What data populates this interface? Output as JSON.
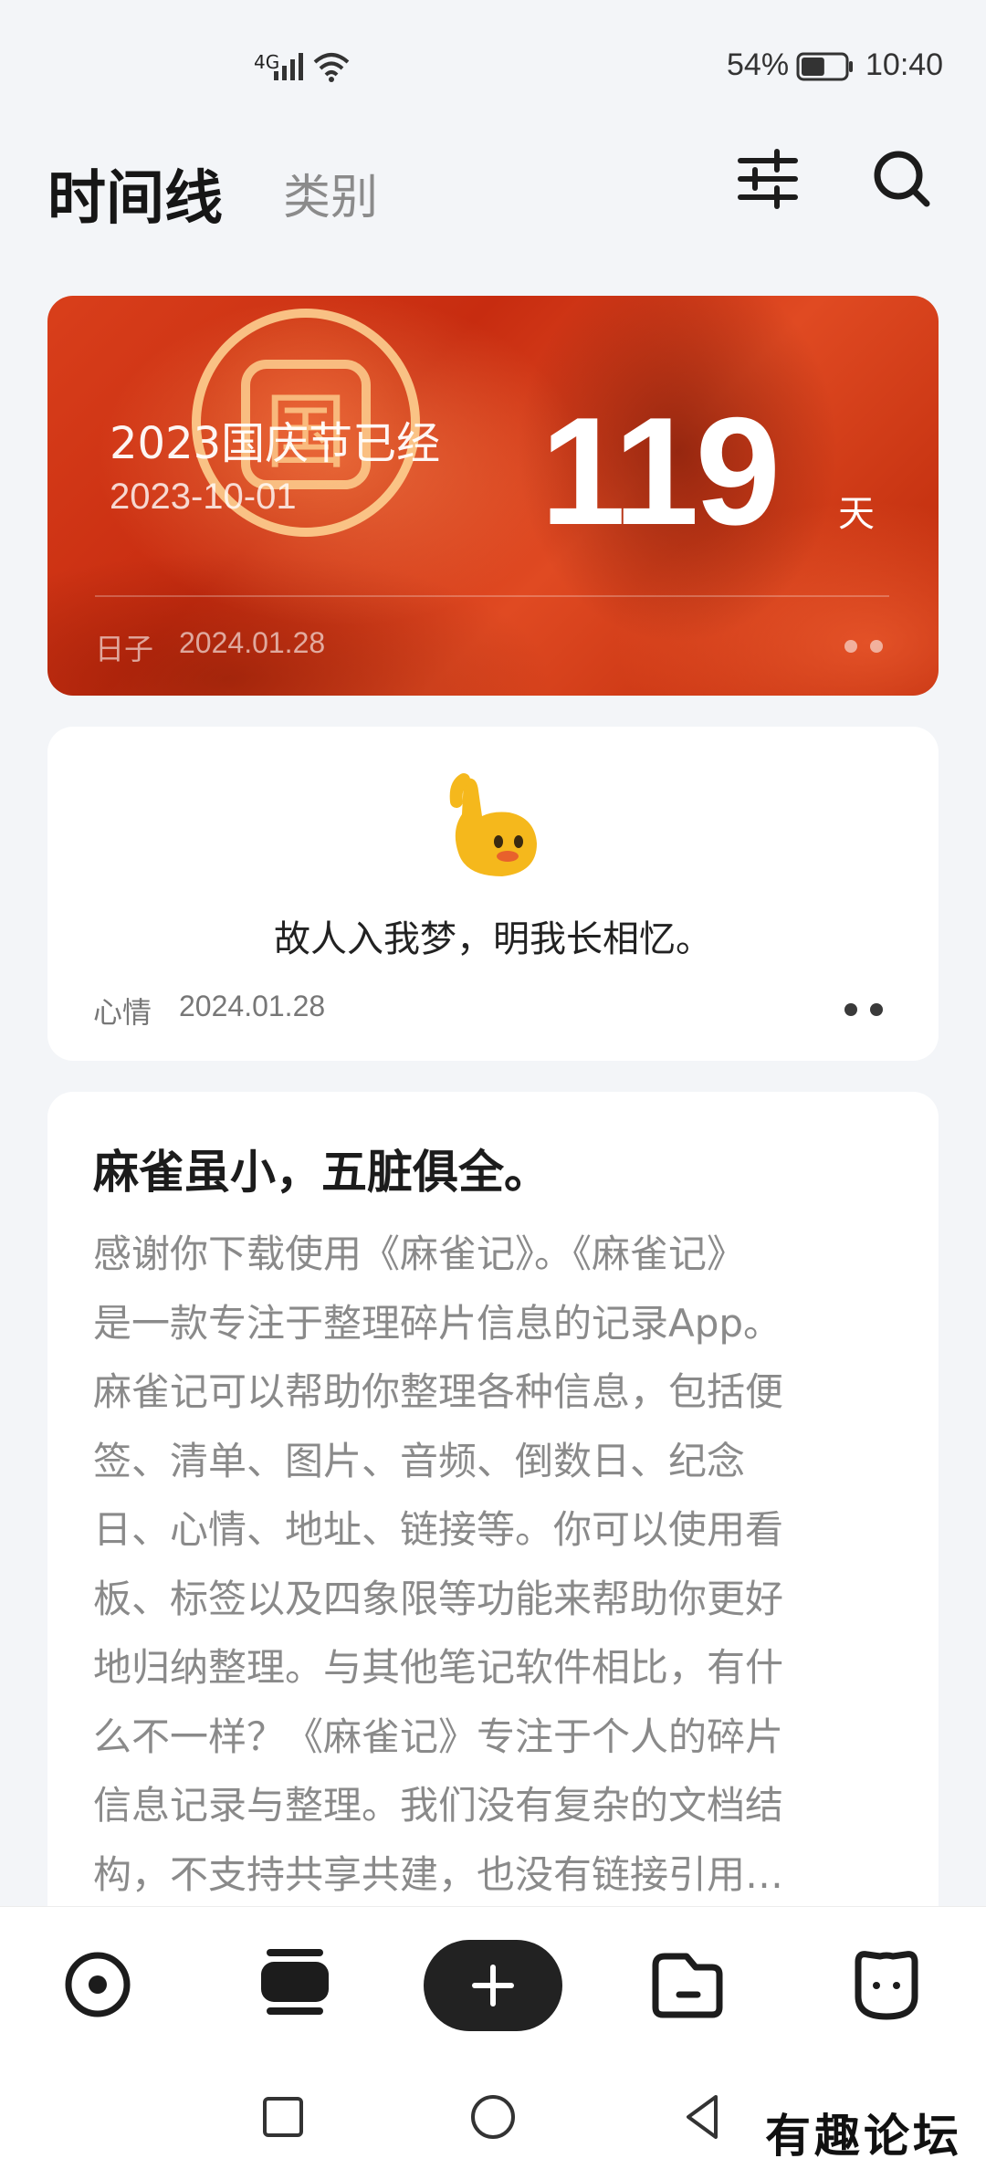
{
  "status_bar": {
    "network": "4G",
    "battery_percent": "54%",
    "time": "10:40",
    "battery_level": 0.54
  },
  "header": {
    "tab_active": "时间线",
    "tab_inactive": "类别",
    "icons": [
      "filter-icon",
      "search-icon"
    ]
  },
  "countdown_card": {
    "title": "2023国庆节已经",
    "date": "2023-10-01",
    "days": "119",
    "unit": "天",
    "category": "日子",
    "created": "2024.01.28",
    "stamp_char": "国"
  },
  "mood_card": {
    "emoji": "waving-hand-emoji",
    "text": "故人入我梦，明我长相忆。",
    "category": "心情",
    "created": "2024.01.28"
  },
  "note_card": {
    "title": "麻雀虽小，五脏俱全。",
    "body_lines": [
      "感谢你下载使用《麻雀记》。《麻雀记》",
      "是一款专注于整理碎片信息的记录App。",
      "麻雀记可以帮助你整理各种信息，包括便",
      "签、清单、图片、音频、倒数日、纪念",
      "日、心情、地址、链接等。你可以使用看",
      "板、标签以及四象限等功能来帮助你更好",
      "地归纳整理。与其他笔记软件相比，有什",
      "么不一样？《麻雀记》专注于个人的碎片",
      "信息记录与整理。我们没有复杂的文档结",
      "构，不支持共享共建，也没有链接引用…"
    ]
  },
  "bottom_nav": {
    "items": [
      "timeline-icon",
      "cards-icon",
      "add-icon",
      "folder-icon",
      "profile-icon"
    ]
  },
  "system_nav": [
    "recent-apps-icon",
    "home-icon",
    "back-icon"
  ],
  "watermark": "有趣论坛",
  "colors": {
    "accent_dark": "#222222",
    "card_red": "#d23a18",
    "background": "#f3f5f8"
  }
}
